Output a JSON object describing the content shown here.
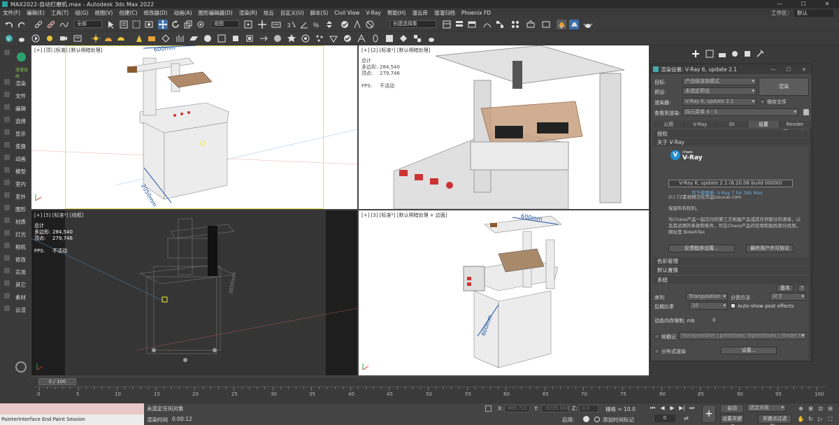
{
  "window": {
    "title": "MAX2022-自动打磨机.max - Autodesk 3ds Max 2022"
  },
  "menu": [
    "文件(F)",
    "编辑(E)",
    "工具(T)",
    "组(G)",
    "视图(V)",
    "创建(C)",
    "修改器(D)",
    "动画(A)",
    "图形编辑器(D)",
    "渲染(R)",
    "炫云",
    "自定义(U)",
    "脚本(S)",
    "Civil View",
    "V-Ray",
    "帮助(H)",
    "溜云库",
    "溜溜归档",
    "Phoenix FD"
  ],
  "workspace": {
    "label": "工作区：",
    "value": "默认"
  },
  "toolbar": {
    "selection_filter": "全部",
    "view_dropdown": "视图",
    "named_selection": "创建选择集"
  },
  "left_panel": {
    "items": [
      "渲染",
      "文件",
      "编辑",
      "选择",
      "显示",
      "变换",
      "动画",
      "模型",
      "室内",
      "室外",
      "图形",
      "材质",
      "灯光",
      "相机",
      "修改",
      "实用",
      "其它",
      "素材",
      "云渲"
    ],
    "logo_subtitle": "溜溜自由"
  },
  "viewports": {
    "top_left": {
      "label": "[+] [顶] [标准] [默认明暗处理]",
      "dimension": "600mm",
      "dimension_side": "2050mm"
    },
    "top_right": {
      "label": "[+] [2] [标准*] [默认明暗处理]",
      "stats_total": "总计",
      "stats": [
        [
          "多边形:",
          "284,540"
        ],
        [
          "顶点:",
          "279,746"
        ]
      ],
      "fps": [
        "FPS:",
        "不活动"
      ]
    },
    "bottom_left": {
      "label": "[+] [5] [标准*] [线框]",
      "stats_total": "总计",
      "stats": [
        [
          "多边形:",
          "284,540"
        ],
        [
          "顶点:",
          "279,746"
        ]
      ],
      "fps": [
        "FPS:",
        "不活动"
      ],
      "dimension": "2050mm"
    },
    "bottom_right": {
      "label": "[+] [3] [标准*] [默认明暗处理 + 边面]",
      "dimension_top": "600mm",
      "dimension_side": "600mm"
    }
  },
  "render_dialog": {
    "title": "渲染设置: V-Ray 6, update 2.1",
    "target_label": "目标:",
    "target_value": "产品级渲染模式",
    "preset_label": "预设:",
    "preset_value": "未选定预设",
    "renderer_label": "渲染器:",
    "renderer_value": "V-Ray 6, update 2.1",
    "save_file_label": "保存文件",
    "view_label": "查看到渲染:",
    "view_value": "四元菜单 4 - 5",
    "render_button": "渲染",
    "tabs": [
      "公用",
      "V-Ray",
      "GI",
      "设置",
      "Render Elements"
    ],
    "rollouts": {
      "license": "授权",
      "about": "关于 V-Ray",
      "color_management": "色彩管理",
      "default_displacement": "默认置换",
      "system": "系统"
    },
    "vray_logo": {
      "brand": "chaos",
      "name": "V-Ray"
    },
    "version": "V-Ray 6, update 2.1 (6.20.06 build 00000)",
    "update_link": "可下载更新: V-Ray 7 for 3ds Max",
    "translation": "(C) TZ素材网汉化作品tzsucai.com",
    "rights": "保留所有权利。",
    "legal_text": "与Chaos产品一起交付的第三方附属产品或其任何部分的清单，以及其适用的条款和条件，可在Chaos产品的信用和版权部分找到，网址是 BokehTex",
    "feedback_button": "反馈程序设置...",
    "eula_button": "最终用户许可协议",
    "system_basic_button": "基本",
    "system_help_button": "?",
    "sequence_label": "序列",
    "sequence_value": "Triangulation",
    "split_label": "分割方法",
    "split_value": "尺寸",
    "post_label": "后期比率",
    "post_value": "10",
    "autoshow_label": "Auto-show post effects",
    "memory_label": "动态内存限制, mb",
    "memory_value": "0",
    "stamp_label": "帧戳记",
    "stamp_value": "%vrayversion | primitives: %primitives | render time: %rendertime",
    "distributed_label": "分布式渲染",
    "settings_button": "设置..."
  },
  "timeline": {
    "slider": "0 / 100",
    "ticks": [
      "0",
      "5",
      "10",
      "15",
      "20",
      "25",
      "30",
      "35",
      "40",
      "45",
      "50",
      "55",
      "60",
      "65",
      "70",
      "75",
      "80",
      "85",
      "90",
      "95",
      "100"
    ]
  },
  "status": {
    "maxscript_output": "PainterInterface End Paint Session",
    "selection": "未选定任何对象",
    "render_time_label": "渲染时间",
    "render_time": "0:00:12",
    "x_label": "X:",
    "x_value": "665.721",
    "y_label": "Y:",
    "y_value": "-3235.024",
    "z_label": "Z:",
    "z_value": "0.0",
    "grid_label": "栅格 = 10.0",
    "enable_label": "启用:",
    "add_time_tag": "添加时间标记",
    "auto_button": "自动",
    "selection_set": "选定对象",
    "set_key_button": "设置关键点",
    "key_filter_button": "关键点过滤器..."
  },
  "colors": {
    "accent": "#1e8fd5",
    "ui_bg": "#3a3a3a",
    "viewport_dark": "#353535"
  }
}
